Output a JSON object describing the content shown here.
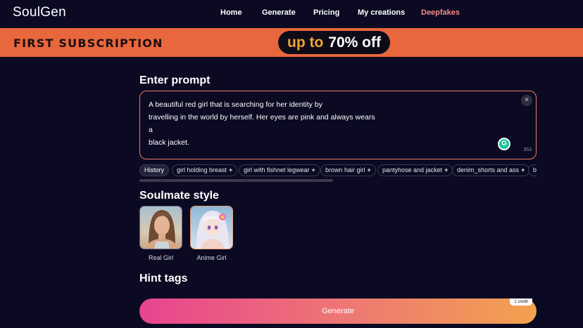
{
  "nav": {
    "logo": "SoulGen",
    "items": [
      "Home",
      "Generate",
      "Pricing",
      "My creations",
      "Deepfakes"
    ]
  },
  "banner": {
    "left_text": "FIRST SUBSCRIPTION",
    "pill_highlight": "up to",
    "pill_main": "70% off"
  },
  "prompt": {
    "title": "Enter prompt",
    "lines": [
      "A beautiful red girl that is searching for her identity by",
      "travelling in the world by herself. Her eyes are pink and always wears a",
      "black jacket."
    ],
    "char_count": "353",
    "clear_label": "×",
    "grammar_label": "G"
  },
  "tags": {
    "history": "History",
    "items": [
      "girl holding breast",
      "girl with fishnet legwear",
      "brown hair girl",
      "pantyhose and jacket",
      "denim_shorts and ass",
      "b"
    ],
    "plus": "+"
  },
  "soulmate": {
    "title": "Soulmate style",
    "options": [
      "Real Girl",
      "Anime Girl"
    ]
  },
  "hint": {
    "title": "Hint tags"
  },
  "generate": {
    "label": "Generate",
    "credit": "1 credit"
  },
  "colors": {
    "background": "#0b0a22",
    "banner": "#e8673c",
    "accent_nav": "#f48a8a",
    "prompt_border": "#ee7a62"
  }
}
